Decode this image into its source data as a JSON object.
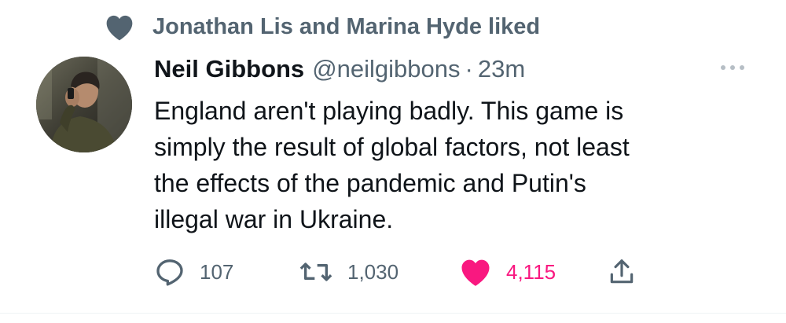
{
  "context": {
    "icon": "heart-icon",
    "text": "Jonathan Lis and Marina Hyde liked"
  },
  "author": {
    "display_name": "Neil Gibbons",
    "handle": "@neilgibbons",
    "separator": "·",
    "time": "23m"
  },
  "tweet": {
    "lines": [
      "England aren't playing badly. This game is",
      "simply the result of global factors, not least",
      "the effects of the pandemic and Putin's",
      "illegal war in Ukraine."
    ]
  },
  "actions": {
    "replies": "107",
    "retweets": "1,030",
    "likes": "4,115"
  },
  "colors": {
    "secondary": "#536471",
    "like": "#f91880",
    "text": "#0f1419"
  }
}
